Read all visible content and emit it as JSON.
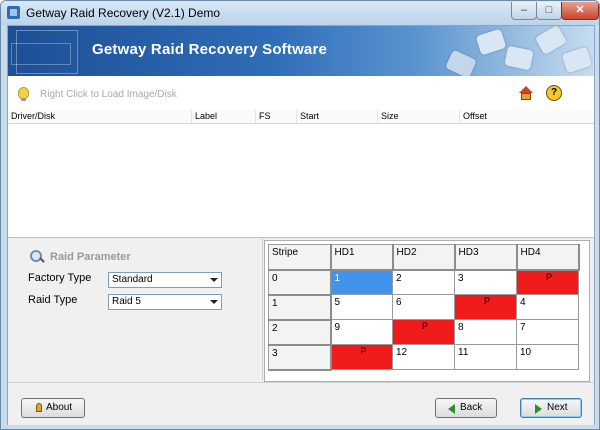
{
  "window": {
    "title": "Getway Raid Recovery (V2.1) Demo"
  },
  "banner": {
    "title": "Getway Raid Recovery Software"
  },
  "toolbar": {
    "hint": "Right Click to Load Image/Disk",
    "home_icon": "home-icon",
    "help_icon": "help-icon",
    "help_glyph": "?"
  },
  "list": {
    "columns": [
      "Driver/Disk",
      "Label",
      "FS",
      "Start",
      "Size",
      "Offset"
    ]
  },
  "raid_parameter": {
    "title": "Raid Parameter",
    "factory_type_label": "Factory Type",
    "factory_type_value": "Standard",
    "raid_type_label": "Raid Type",
    "raid_type_value": "Raid 5"
  },
  "stripe_table": {
    "headers": [
      "Stripe",
      "HD1",
      "HD2",
      "HD3",
      "HD4"
    ],
    "rows": [
      {
        "stripe": "0",
        "cells": [
          "1",
          "2",
          "3",
          "P"
        ]
      },
      {
        "stripe": "1",
        "cells": [
          "5",
          "6",
          "P",
          "4"
        ]
      },
      {
        "stripe": "2",
        "cells": [
          "9",
          "P",
          "8",
          "7"
        ]
      },
      {
        "stripe": "3",
        "cells": [
          "P",
          "12",
          "11",
          "10"
        ]
      }
    ],
    "selected_color": "#3f93ea",
    "parity_color": "#f21b1b"
  },
  "buttons": {
    "about": "About",
    "back": "Back",
    "next": "Next"
  }
}
